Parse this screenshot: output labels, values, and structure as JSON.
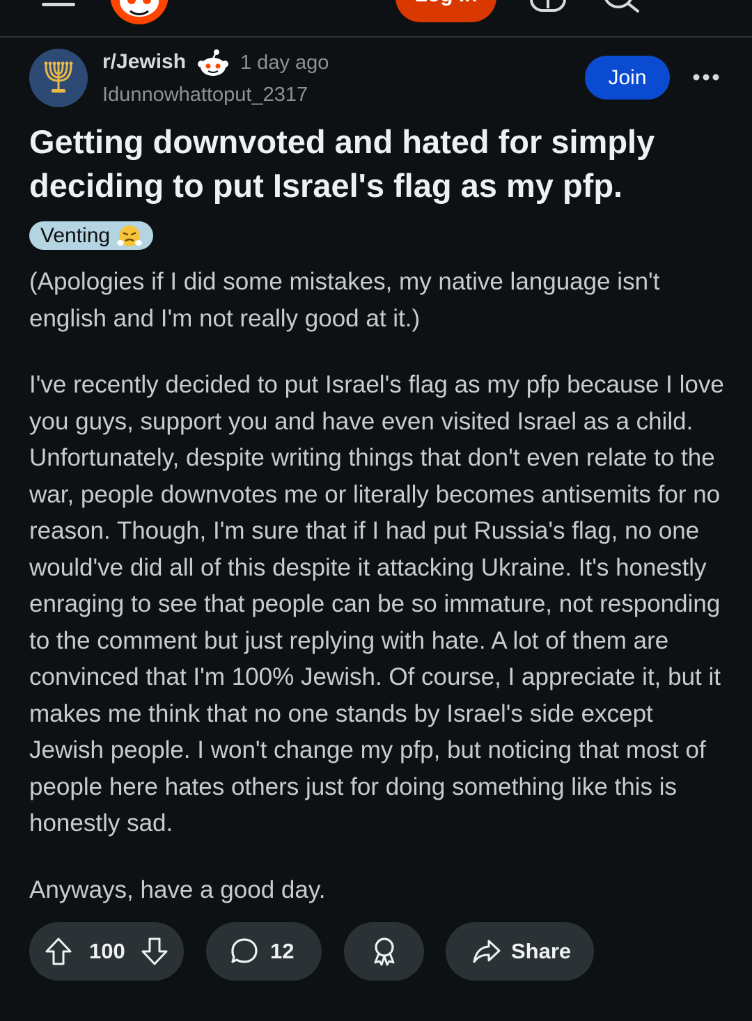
{
  "header": {
    "login_label": "Log In"
  },
  "post": {
    "subreddit": "r/Jewish",
    "time": "1 day ago",
    "author": "Idunnowhattoput_2317",
    "join_label": "Join",
    "title": "Getting downvoted and hated for simply deciding to put Israel's flag as my pfp.",
    "flair": "Venting",
    "body": [
      "(Apologies if I did some mistakes, my native language isn't english and I'm not really good at it.)",
      "I've recently decided to put Israel's flag as my pfp because I love you guys, support you and have even visited Israel as a child. Unfortunately, despite writing things that don't even relate to the war, people downvotes me or literally becomes antisemits for no reason. Though, I'm sure that if I had put Russia's flag, no one would've did all of this despite it attacking Ukraine. It's honestly enraging to see that people can be so immature, not responding to the comment but just replying with hate. A lot of them are convinced that I'm 100% Jewish. Of course, I appreciate it, but it makes me think that no one stands by Israel's side except Jewish people. I won't change my pfp, but noticing that most of people here hates others just for doing something like this is honestly sad.",
      "Anyways, have a good day."
    ]
  },
  "actions": {
    "votes": "100",
    "comments": "12",
    "share_label": "Share"
  },
  "icons": {
    "menu": "hamburger-menu-icon",
    "logo": "reddit-logo-icon",
    "chat": "chat-icon",
    "search": "search-icon",
    "subreddit_avatar": "menorah-icon",
    "snoo": "snoo-icon",
    "more": "more-options-icon",
    "flair_emoji": "steam-nose-face-icon",
    "upvote": "upvote-arrow-icon",
    "downvote": "downvote-arrow-icon",
    "comment": "comment-bubble-icon",
    "award": "award-icon",
    "share": "share-arrow-icon"
  },
  "colors": {
    "background": "#0e1113",
    "join_button": "#0a4bd1",
    "login_button": "#d93900",
    "flair_bg": "#b3d4e0",
    "avatar_bg": "#2d4a75",
    "action_bg": "#2a3236"
  }
}
